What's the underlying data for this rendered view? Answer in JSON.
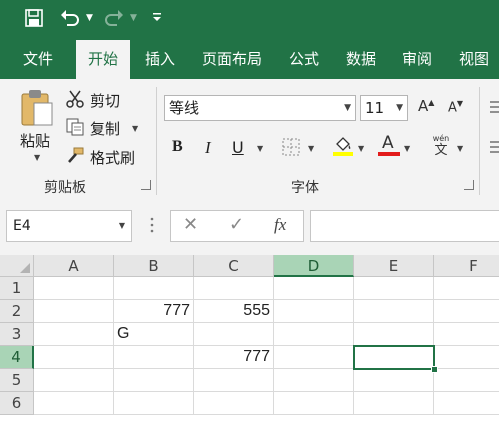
{
  "colors": {
    "accent": "#217346",
    "selected_header": "#a9d4b6",
    "ribbon_bg": "#f3f3f3"
  },
  "qat": {
    "save_icon": "save-icon",
    "undo_icon": "undo-icon",
    "redo_icon": "redo-icon",
    "customize_icon": "customize-qat-icon"
  },
  "tabs": [
    "文件",
    "开始",
    "插入",
    "页面布局",
    "公式",
    "数据",
    "审阅",
    "视图"
  ],
  "active_tab": "开始",
  "clipboard": {
    "paste": "粘贴",
    "cut": "剪切",
    "copy": "复制",
    "format_painter": "格式刷",
    "group_label": "剪贴板"
  },
  "font": {
    "name": "等线",
    "size": "11",
    "bold": "B",
    "italic": "I",
    "underline": "U",
    "font_color_letter": "A",
    "phonetic_top": "wén",
    "phonetic_bottom": "文",
    "group_label": "字体",
    "grow": "A",
    "shrink": "A"
  },
  "formula_bar": {
    "name_box": "E4",
    "cancel": "✕",
    "enter": "✓",
    "fx": "fx",
    "content": ""
  },
  "grid": {
    "columns": [
      "A",
      "B",
      "C",
      "D",
      "E",
      "F"
    ],
    "rows": [
      "1",
      "2",
      "3",
      "4",
      "5",
      "6"
    ],
    "cells": {
      "B2": "777",
      "C2": "555",
      "B3": "G",
      "C4": "777"
    },
    "active_cell": "E4",
    "selected_column": "D",
    "selected_row": "4"
  }
}
